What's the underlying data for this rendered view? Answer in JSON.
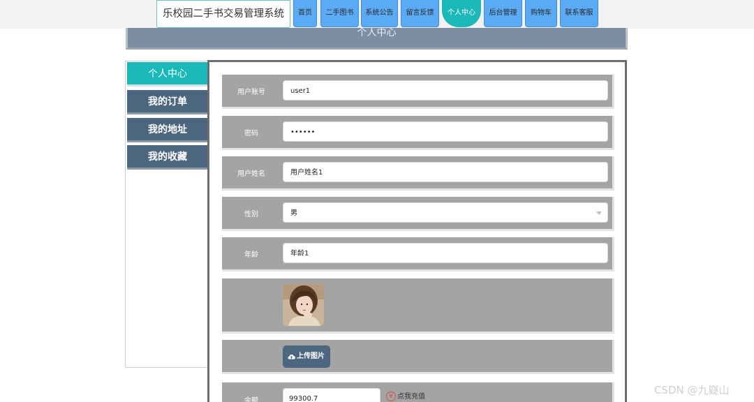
{
  "app": {
    "title": "乐校园二手书交易管理系统"
  },
  "nav": {
    "items": [
      {
        "label": "首页"
      },
      {
        "label": "二手图书"
      },
      {
        "label": "系统公告"
      },
      {
        "label": "留言反馈"
      },
      {
        "label": "个人中心",
        "active": true
      },
      {
        "label": "后台管理"
      },
      {
        "label": "购物车"
      },
      {
        "label": "联系客服"
      }
    ]
  },
  "page_header": {
    "title": "个人中心"
  },
  "sidebar": {
    "items": [
      {
        "label": "个人中心",
        "active": true
      },
      {
        "label": "我的订单"
      },
      {
        "label": "我的地址"
      },
      {
        "label": "我的收藏"
      }
    ]
  },
  "form": {
    "account": {
      "label": "用户账号",
      "value": "user1"
    },
    "password": {
      "label": "密码",
      "value": "••••••"
    },
    "name": {
      "label": "用户姓名",
      "value": "用户姓名1"
    },
    "gender": {
      "label": "性别",
      "value": "男"
    },
    "age": {
      "label": "年龄",
      "value": "年龄1"
    },
    "avatar": {
      "icon": "user-photo"
    },
    "upload": {
      "label": "上传图片",
      "icon": "cloud-upload-icon"
    },
    "balance": {
      "label": "余额",
      "value": "99300.7",
      "recharge_label": "点我充值",
      "recharge_icon": "yen-icon"
    }
  },
  "colors": {
    "nav_blue": "#5aaaf5",
    "accent_teal": "#1ab8b8",
    "sidebar_slate": "#4d6680",
    "row_gray": "#a4a4a4"
  },
  "watermark": {
    "text": "CSDN @九嶷山"
  }
}
